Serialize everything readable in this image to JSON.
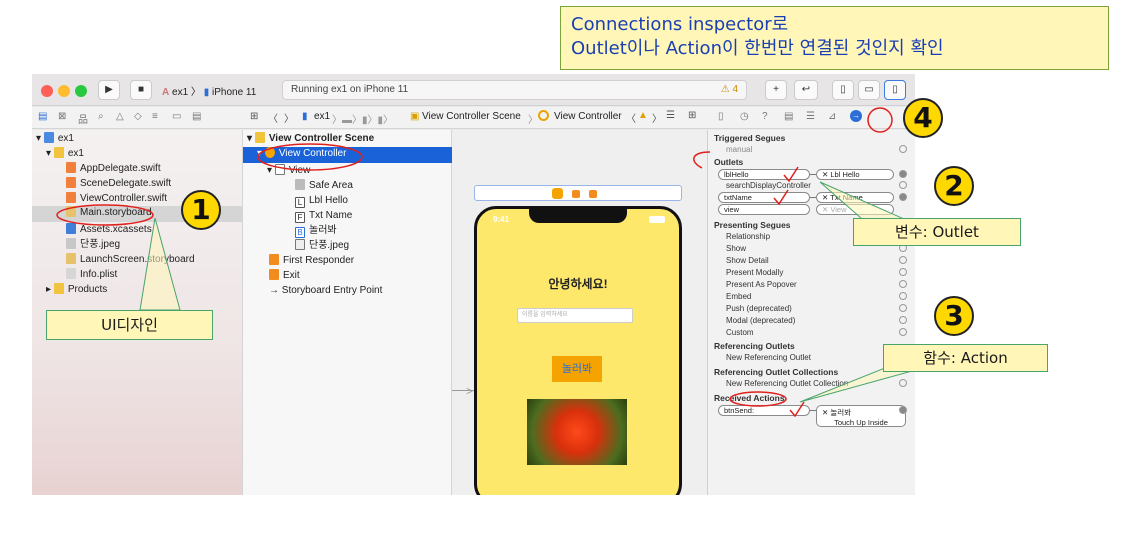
{
  "callout": {
    "line1": "Connections inspector로",
    "line2": "Outlet이나 Action이 한번만 연결된 것인지 확인"
  },
  "toolbar": {
    "scheme_project": "ex1",
    "scheme_device": "iPhone 11",
    "status_text": "Running ex1 on iPhone 11",
    "warning_count": "4"
  },
  "jumpbar": [
    "ex1",
    "View Controller Scene",
    "View Controller"
  ],
  "navigator": {
    "items": [
      {
        "label": "ex1",
        "type": "project"
      },
      {
        "label": "ex1",
        "type": "folder"
      },
      {
        "label": "AppDelegate.swift",
        "type": "swift"
      },
      {
        "label": "SceneDelegate.swift",
        "type": "swift"
      },
      {
        "label": "ViewController.swift",
        "type": "swift"
      },
      {
        "label": "Main.storyboard",
        "type": "storyboard"
      },
      {
        "label": "Assets.xcassets",
        "type": "assets"
      },
      {
        "label": "단풍.jpeg",
        "type": "image"
      },
      {
        "label": "LaunchScreen.storyboard",
        "type": "storyboard"
      },
      {
        "label": "Info.plist",
        "type": "plist"
      },
      {
        "label": "Products",
        "type": "folder"
      }
    ]
  },
  "outline": {
    "items": [
      {
        "label": "View Controller Scene"
      },
      {
        "label": "View Controller"
      },
      {
        "label": "View"
      },
      {
        "label": "Safe Area"
      },
      {
        "label": "Lbl Hello"
      },
      {
        "label": "Txt Name"
      },
      {
        "label": "놀러봐"
      },
      {
        "label": "단풍.jpeg"
      },
      {
        "label": "First Responder"
      },
      {
        "label": "Exit"
      },
      {
        "label": "Storyboard Entry Point"
      }
    ]
  },
  "phone": {
    "time": "9:41",
    "greeting": "안녕하세요!",
    "placeholder": "이름을 입력하세요",
    "button_label": "놀러봐"
  },
  "inspector": {
    "triggered_segues": "Triggered Segues",
    "manual": "manual",
    "outlets": "Outlets",
    "outlet_rows": [
      {
        "name": "lblHello",
        "target": "Lbl Hello"
      },
      {
        "name": "searchDisplayController",
        "target": ""
      },
      {
        "name": "txtName",
        "target": "Txt Name"
      },
      {
        "name": "view",
        "target": "View"
      }
    ],
    "presenting_segues": "Presenting Segues",
    "segue_rows": [
      "Relationship",
      "Show",
      "Show Detail",
      "Present Modally",
      "Present As Popover",
      "Embed",
      "Push (deprecated)",
      "Modal (deprecated)",
      "Custom"
    ],
    "referencing_outlets": "Referencing Outlets",
    "new_ref_outlet": "New Referencing Outlet",
    "referencing_collections": "Referencing Outlet Collections",
    "new_ref_collection": "New Referencing Outlet Collection",
    "received_actions": "Received Actions",
    "action_name": "btnSend:",
    "action_target": "놀러봐",
    "action_event": "Touch Up Inside"
  },
  "annotations": {
    "n1": "1",
    "n2": "2",
    "n3": "3",
    "n4": "4",
    "ui_design": "UI디자인",
    "var_outlet": "변수: Outlet",
    "func_action": "함수: Action"
  },
  "colors": {
    "callout_bg": "#fff6b8",
    "callout_text": "#1a3fb4",
    "badge_fill": "#ffd800",
    "selection": "#1a62d8",
    "annotation_red": "#e0201c"
  }
}
